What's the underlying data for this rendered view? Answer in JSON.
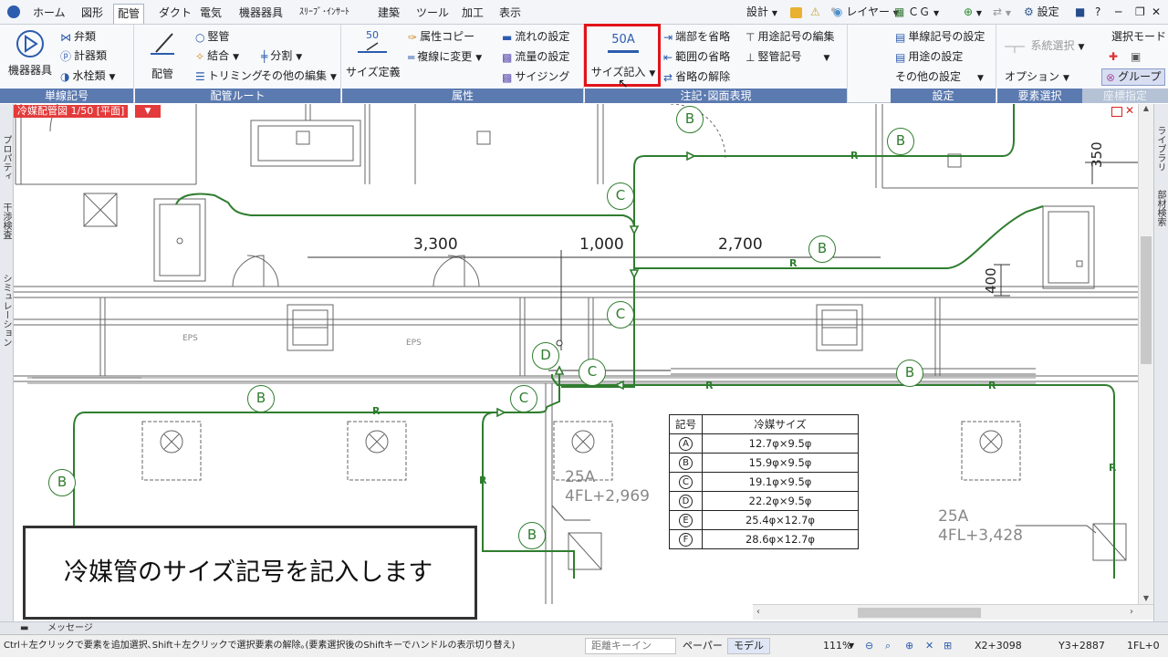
{
  "menubar": {
    "tabs": [
      "ホーム",
      "図形",
      "配管",
      "ダクト",
      "電気",
      "機器器具",
      "ｽﾘｰﾌﾞ･ｲﾝｻｰﾄ",
      "建築",
      "ツール",
      "加工",
      "表示"
    ],
    "right": {
      "design": "設計",
      "layer": "レイヤー",
      "cg": "ＣＧ",
      "settings": "設定"
    }
  },
  "ribbon": {
    "single_line": {
      "label": "単線記号",
      "equipment": "機器器具",
      "valve": "弁類",
      "meter": "計器類",
      "faucet": "水栓類"
    },
    "route": {
      "label": "配管ルート",
      "pipe": "配管",
      "riser": "竪管",
      "join": "結合",
      "split": "分割",
      "trim": "トリミング",
      "other_edit": "その他の編集"
    },
    "attr": {
      "label": "属性",
      "size_define": "サイズ定義",
      "size_value": "50",
      "attr_copy": "属性コピー",
      "to_double": "複線に変更",
      "flow_set": "流れの設定",
      "flow_amount": "流量の設定",
      "sizing": "サイジング"
    },
    "annot": {
      "label": "注記･図面表現",
      "size_input": "サイズ記入",
      "size_badge": "50A",
      "omit_end": "端部を省略",
      "omit_range": "範囲の省略",
      "omit_cancel": "省略の解除",
      "use_symbol_edit": "用途記号の編集",
      "riser_symbol": "竪管記号"
    },
    "settings": {
      "label": "設定",
      "single_symbol_set": "単線記号の設定",
      "use_set": "用途の設定",
      "other_set": "その他の設定"
    },
    "select": {
      "label": "要素選択",
      "system_select": "系統選択",
      "option": "オプション",
      "select_mode": "選択モード",
      "group": "グループ",
      "coord": "座標指定"
    }
  },
  "view": {
    "tab": "冷媒配管図 1/50 [平面]"
  },
  "side_tabs": {
    "left": [
      "プロパティ",
      "干渉検査",
      "シミュレーション"
    ],
    "right": [
      "ライブラリ",
      "部材検索"
    ]
  },
  "drawing": {
    "dims": {
      "d1": "3,300",
      "d2": "1,000",
      "d3": "2,700",
      "v1": "350",
      "v2": "400"
    },
    "labels": {
      "eps1": "EPS",
      "eps2": "EPS",
      "size1": "25A",
      "level1": "4FL+2,969",
      "size2": "25A",
      "level2": "4FL+3,428"
    },
    "bubbles": [
      "B",
      "B",
      "B",
      "B",
      "B",
      "B",
      "B",
      "C",
      "C",
      "C",
      "C",
      "D"
    ],
    "r": "R"
  },
  "table": {
    "headers": [
      "記号",
      "冷媒サイズ"
    ],
    "rows": [
      {
        "sym": "A",
        "size": "12.7φ×9.5φ"
      },
      {
        "sym": "B",
        "size": "15.9φ×9.5φ"
      },
      {
        "sym": "C",
        "size": "19.1φ×9.5φ"
      },
      {
        "sym": "D",
        "size": "22.2φ×9.5φ"
      },
      {
        "sym": "E",
        "size": "25.4φ×12.7φ"
      },
      {
        "sym": "F",
        "size": "28.6φ×12.7φ"
      }
    ]
  },
  "caption": "冷媒管のサイズ記号を記入します",
  "messages": {
    "panel": "メッセージ",
    "hint": "Ctrl＋左クリックで要素を追加選択､Shift＋左クリックで選択要素の解除｡(要素選択後のShiftキーでハンドルの表示切り替え)"
  },
  "status": {
    "distance": "距離キーイン",
    "paper": "ペーパー",
    "model": "モデル",
    "zoom": "111%",
    "x": "X2+3098",
    "y": "Y3+2887",
    "floor": "1FL+0"
  },
  "colors": {
    "pipe": "#2f7d2f",
    "highlight": "#e1141a",
    "group_label": "#5b7ab0"
  }
}
